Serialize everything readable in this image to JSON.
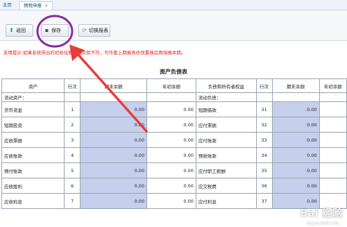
{
  "tabs": {
    "home": "主页",
    "active": "预税申报",
    "close": "×"
  },
  "toolbar": {
    "back_label": "返回",
    "save_label": "保存",
    "switch_label": "切换报表"
  },
  "notice": "友情提示:如果系统带出的初始化数据与实际不符，可作废上期报表修改重报后再填报本期。",
  "report_title": "资产负债表",
  "table": {
    "headers": [
      "资产",
      "行次",
      "期末余额",
      "年初余额",
      "负债和所有者权益",
      "行次",
      "期末余额",
      "年初余额"
    ],
    "section_left": "流动资产：",
    "section_right": "流动负债：",
    "rows": [
      {
        "asset": "货币资金",
        "line": "1",
        "end": "0.00",
        "begin": "0.00",
        "liab": "短期借款",
        "line2": "31",
        "end2": "0.00"
      },
      {
        "asset": "短期投资",
        "line": "2",
        "end": "0.00",
        "begin": "0.00",
        "liab": "应付票据",
        "line2": "32",
        "end2": "0.00"
      },
      {
        "asset": "应收票据",
        "line": "3",
        "end": "0.00",
        "begin": "0.00",
        "liab": "应付账款",
        "line2": "33",
        "end2": "0.00"
      },
      {
        "asset": "应收账款",
        "line": "4",
        "end": "0.00",
        "begin": "0.00",
        "liab": "预收账款",
        "line2": "34",
        "end2": "0.00"
      },
      {
        "asset": "预付账款",
        "line": "5",
        "end": "0.00",
        "begin": "0.00",
        "liab": "应付职工薪酬",
        "line2": "35",
        "end2": "0.00"
      },
      {
        "asset": "应收股利",
        "line": "6",
        "end": "0.00",
        "begin": "0.00",
        "liab": "应交税费",
        "line2": "36",
        "end2": "0.00"
      },
      {
        "asset": "应收利息",
        "line": "7",
        "end": "0.00",
        "begin": "0.00",
        "liab": "应付利息",
        "line2": "37",
        "end2": "0.00"
      }
    ]
  },
  "watermark": {
    "main": "Bai 经验",
    "sub": "jingyan.baidu.com"
  },
  "annotation": {
    "circle_color": "#8a2aa0",
    "arrow_color": "#e83c3c"
  }
}
